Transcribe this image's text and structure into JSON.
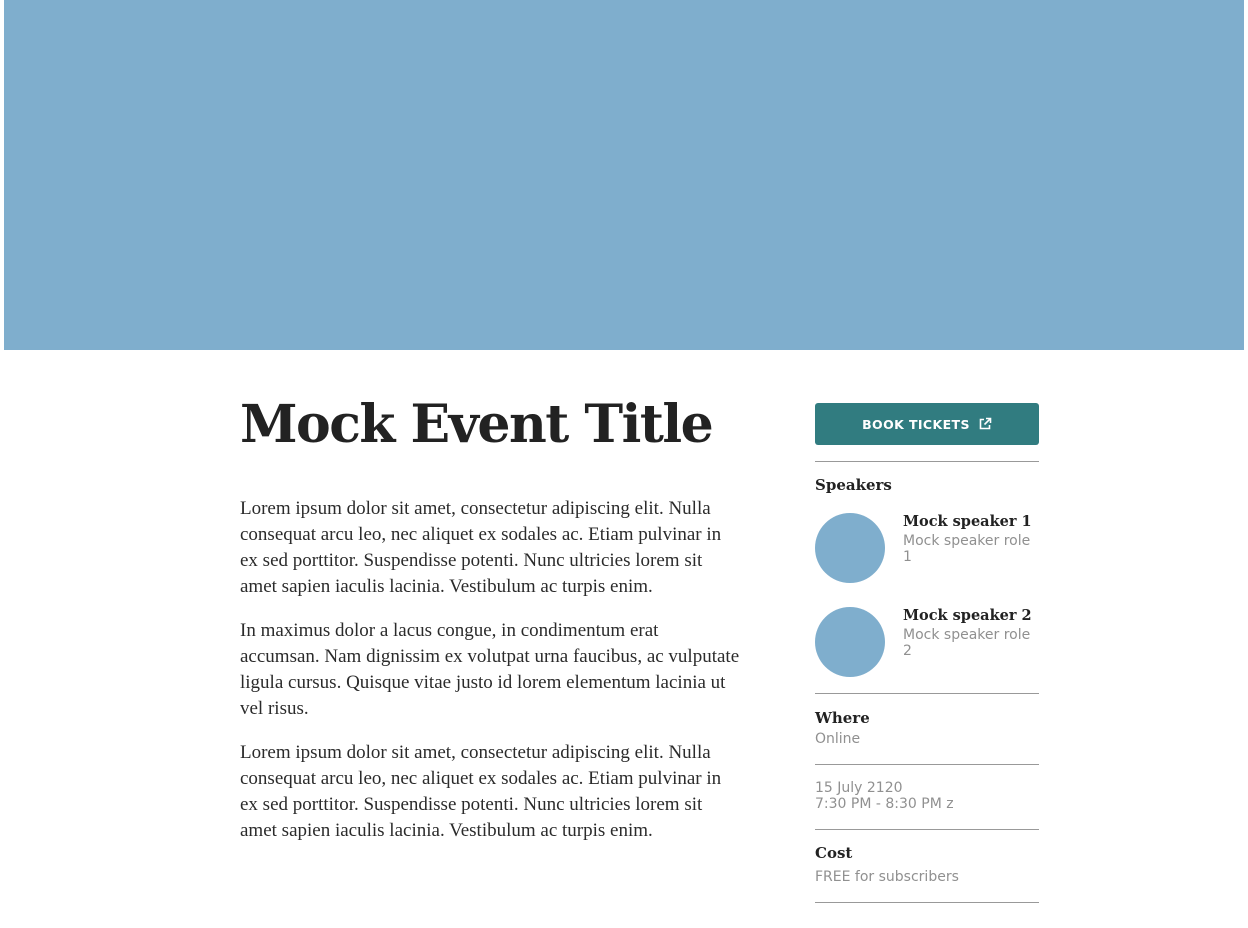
{
  "hero": {
    "color": "#7faecd"
  },
  "event": {
    "title": "Mock Event Title",
    "paragraphs": [
      "Lorem ipsum dolor sit amet, consectetur adipiscing elit. Nulla consequat arcu leo, nec aliquet ex sodales ac. Etiam pulvinar in ex sed porttitor. Suspendisse potenti. Nunc ultricies lorem sit amet sapien iaculis lacinia. Vestibulum ac turpis enim.",
      "In maximus dolor a lacus congue, in condimentum erat accumsan. Nam dignissim ex volutpat urna faucibus, ac vulputate ligula cursus. Quisque vitae justo id lorem elementum lacinia ut vel risus.",
      "Lorem ipsum dolor sit amet, consectetur adipiscing elit. Nulla consequat arcu leo, nec aliquet ex sodales ac. Etiam pulvinar in ex sed porttitor. Suspendisse potenti. Nunc ultricies lorem sit amet sapien iaculis lacinia. Vestibulum ac turpis enim."
    ]
  },
  "sidebar": {
    "book_button": {
      "label": "BOOK TICKETS",
      "icon": "external-link-icon",
      "color": "#317c80"
    },
    "speakers": {
      "label": "Speakers",
      "items": [
        {
          "name": "Mock speaker 1",
          "role": "Mock speaker role 1"
        },
        {
          "name": "Mock speaker 2",
          "role": "Mock speaker role 2"
        }
      ]
    },
    "where": {
      "label": "Where",
      "value": "Online"
    },
    "when": {
      "date": "15 July 2120",
      "time": "7:30 PM - 8:30 PM z"
    },
    "cost": {
      "label": "Cost",
      "value": "FREE for subscribers"
    }
  }
}
